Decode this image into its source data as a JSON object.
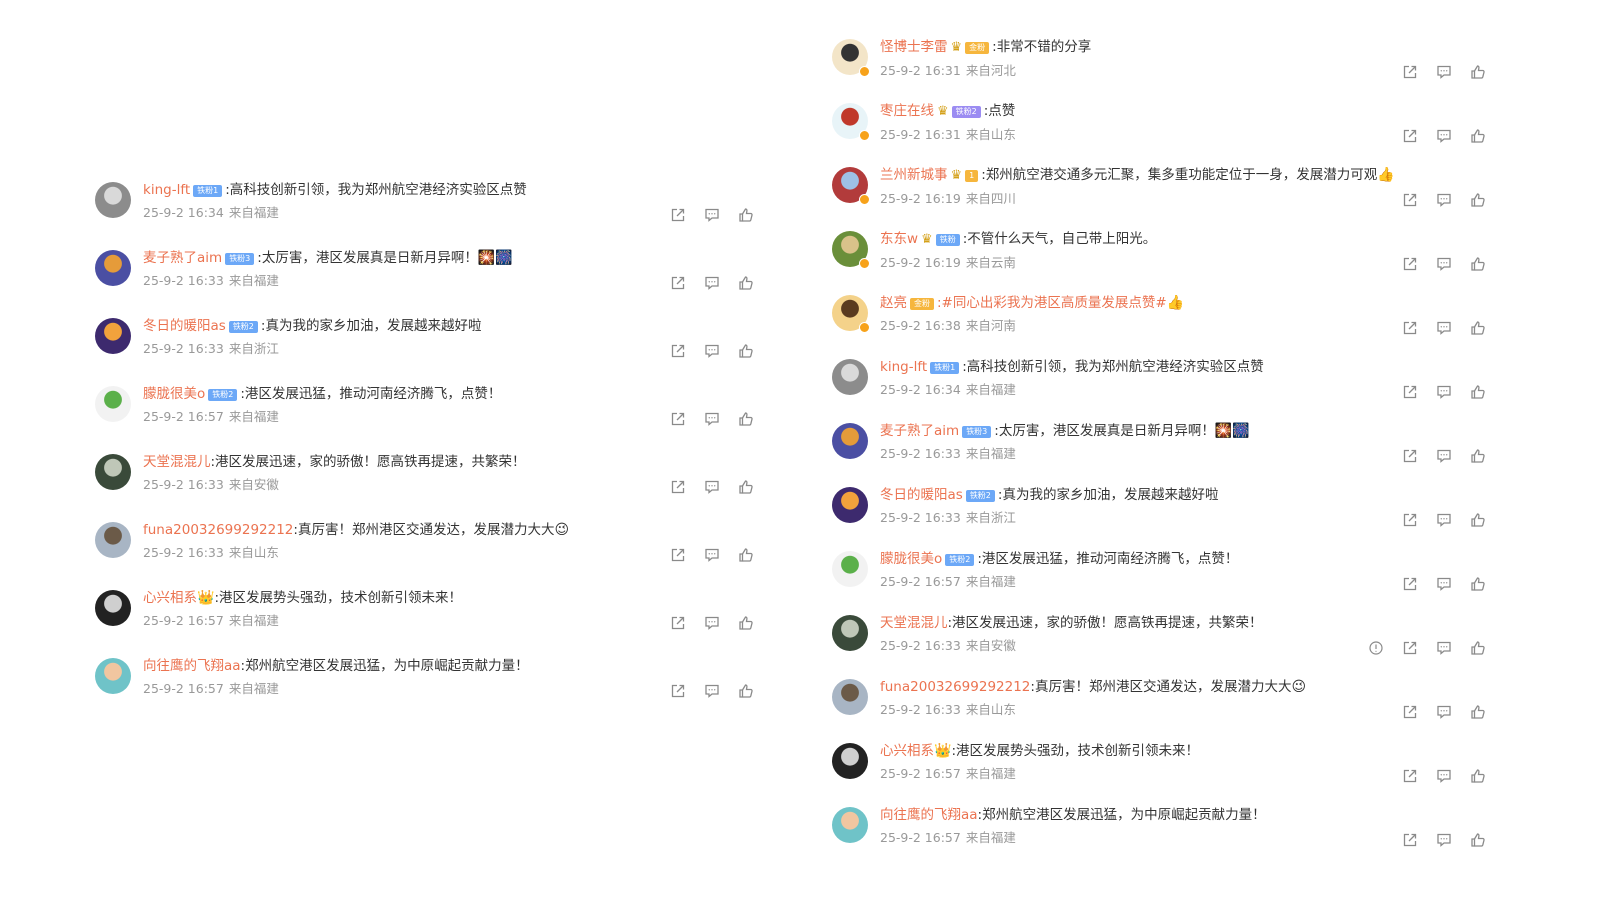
{
  "left_panel": {
    "comments": [
      {
        "user": "king-lft",
        "badge": "铁粉1",
        "badge_color": "blue",
        "text": ":高科技创新引领，我为郑州航空港经济实验区点赞",
        "time": "25-9-2 16:34",
        "source": "来自福建",
        "avatar": [
          "#8c8c8c",
          "#d9d9d9"
        ]
      },
      {
        "user": "麦子熟了aim",
        "badge": "铁粉3",
        "badge_color": "blue",
        "text": ":太厉害，港区发展真是日新月异啊！",
        "emoji": "🎇🎆",
        "time": "25-9-2 16:33",
        "source": "来自福建",
        "avatar": [
          "#4b4fa3",
          "#e59b3a"
        ]
      },
      {
        "user": "冬日的暖阳as",
        "badge": "铁粉2",
        "badge_color": "blue",
        "text": ":真为我的家乡加油，发展越来越好啦",
        "time": "25-9-2 16:33",
        "source": "来自浙江",
        "avatar": [
          "#3d2a6e",
          "#f2a23c"
        ]
      },
      {
        "user": "朦胧很美o",
        "badge": "铁粉2",
        "badge_color": "blue",
        "text": ":港区发展迅猛，推动河南经济腾飞，点赞！",
        "time": "25-9-2 16:57",
        "source": "来自福建",
        "avatar": [
          "#f2f2f2",
          "#5bb04a"
        ]
      },
      {
        "user": "天堂混混儿",
        "text": ":港区发展迅速，家的骄傲！愿高铁再提速，共繁荣！",
        "time": "25-9-2 16:33",
        "source": "来自安徽",
        "avatar": [
          "#3a4a3a",
          "#bfc7b8"
        ]
      },
      {
        "user": "funa20032699292212",
        "text": ":真厉害！郑州港区交通发达，发展潜力大大",
        "emoji": "😉",
        "time": "25-9-2 16:33",
        "source": "来自山东",
        "avatar": [
          "#a8b5c4",
          "#6b5a48"
        ]
      },
      {
        "user": "心兴相系",
        "crown_emoji": "👑",
        "text": ":港区发展势头强劲，技术创新引领未来！",
        "time": "25-9-2 16:57",
        "source": "来自福建",
        "avatar": [
          "#222",
          "#cfcfcf"
        ]
      },
      {
        "user": "向往鹰的飞翔aa",
        "text": ":郑州航空港区发展迅猛，为中原崛起贡献力量！",
        "time": "25-9-2 16:57",
        "source": "来自福建",
        "avatar": [
          "#6fc3c8",
          "#f1c6a0"
        ]
      }
    ]
  },
  "right_panel": {
    "comments": [
      {
        "user": "怪博士李雷",
        "crown": "♛",
        "badge": "金粉",
        "badge_color": "gold",
        "text": ":非常不错的分享",
        "time": "25-9-2 16:31",
        "source": "来自河北",
        "avatar": [
          "#f3e5c8",
          "#333"
        ],
        "verified": true
      },
      {
        "user": "枣庄在线",
        "crown": "♛",
        "badge": "铁粉2",
        "badge_color": "purple",
        "text": ":点赞",
        "time": "25-9-2 16:31",
        "source": "来自山东",
        "avatar": [
          "#e8f4f8",
          "#c0392b"
        ],
        "verified": true
      },
      {
        "user": "兰州新城事",
        "crown": "♛",
        "badge": "1",
        "badge_color": "gold",
        "text": ":郑州航空港交通多元汇聚，集多重功能定位于一身，发展潜力可观",
        "emoji": "👍",
        "time": "25-9-2 16:19",
        "source": "来自四川",
        "avatar": [
          "#b23b3b",
          "#9ec1e6"
        ],
        "verified": true
      },
      {
        "user": "东东w",
        "crown": "♛",
        "badge": "铁粉",
        "badge_color": "blue",
        "text": ":不管什么天气，自己带上阳光。",
        "time": "25-9-2 16:19",
        "source": "来自云南",
        "avatar": [
          "#6a8f3a",
          "#d9c28a"
        ],
        "verified": true
      },
      {
        "user": "赵亮",
        "badge": "金粉",
        "badge_color": "gold",
        "text": ":#同心出彩我为港区高质量发展点赞#",
        "text_color": "#eb7350",
        "emoji": "👍",
        "time": "25-9-2 16:38",
        "source": "来自河南",
        "avatar": [
          "#f4d28a",
          "#5a3b1f"
        ],
        "verified": true
      },
      {
        "user": "king-lft",
        "badge": "铁粉1",
        "badge_color": "blue",
        "text": ":高科技创新引领，我为郑州航空港经济实验区点赞",
        "time": "25-9-2 16:34",
        "source": "来自福建",
        "avatar": [
          "#8c8c8c",
          "#d9d9d9"
        ]
      },
      {
        "user": "麦子熟了aim",
        "badge": "铁粉3",
        "badge_color": "blue",
        "text": ":太厉害，港区发展真是日新月异啊！",
        "emoji": "🎇🎆",
        "time": "25-9-2 16:33",
        "source": "来自福建",
        "avatar": [
          "#4b4fa3",
          "#e59b3a"
        ]
      },
      {
        "user": "冬日的暖阳as",
        "badge": "铁粉2",
        "badge_color": "blue",
        "text": ":真为我的家乡加油，发展越来越好啦",
        "time": "25-9-2 16:33",
        "source": "来自浙江",
        "avatar": [
          "#3d2a6e",
          "#f2a23c"
        ]
      },
      {
        "user": "朦胧很美o",
        "badge": "铁粉2",
        "badge_color": "blue",
        "text": ":港区发展迅猛，推动河南经济腾飞，点赞！",
        "time": "25-9-2 16:57",
        "source": "来自福建",
        "avatar": [
          "#f2f2f2",
          "#5bb04a"
        ]
      },
      {
        "user": "天堂混混儿",
        "text": ":港区发展迅速，家的骄傲！愿高铁再提速，共繁荣！",
        "time": "25-9-2 16:33",
        "source": "来自安徽",
        "avatar": [
          "#3a4a3a",
          "#bfc7b8"
        ],
        "report": true
      },
      {
        "user": "funa20032699292212",
        "text": ":真厉害！郑州港区交通发达，发展潜力大大",
        "emoji": "😉",
        "time": "25-9-2 16:33",
        "source": "来自山东",
        "avatar": [
          "#a8b5c4",
          "#6b5a48"
        ]
      },
      {
        "user": "心兴相系",
        "crown_emoji": "👑",
        "text": ":港区发展势头强劲，技术创新引领未来！",
        "time": "25-9-2 16:57",
        "source": "来自福建",
        "avatar": [
          "#222",
          "#cfcfcf"
        ]
      },
      {
        "user": "向往鹰的飞翔aa",
        "text": ":郑州航空港区发展迅猛，为中原崛起贡献力量！",
        "time": "25-9-2 16:57",
        "source": "来自福建",
        "avatar": [
          "#6fc3c8",
          "#f1c6a0"
        ]
      }
    ]
  },
  "icons": {
    "report": "report-icon",
    "share": "share-icon",
    "comment": "comment-icon",
    "like": "like-icon"
  },
  "colors": {
    "username": "#eb7350",
    "meta": "#999999",
    "text": "#333333",
    "icon": "#8a8a8a"
  }
}
